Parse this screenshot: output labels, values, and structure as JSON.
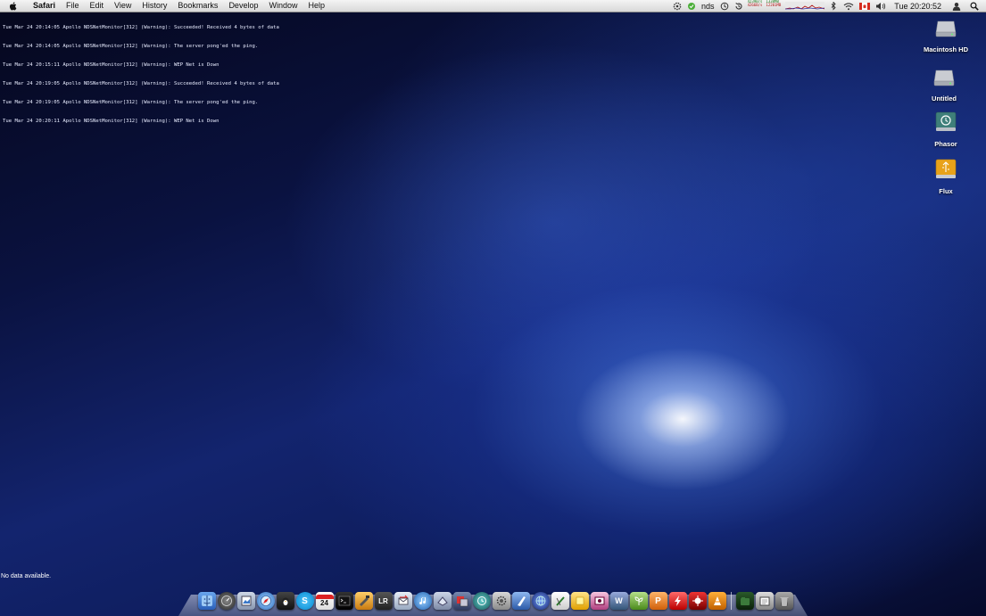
{
  "menubar": {
    "app_name": "Safari",
    "items": [
      "File",
      "Edit",
      "View",
      "History",
      "Bookmarks",
      "Develop",
      "Window",
      "Help"
    ],
    "status_text": "nds",
    "net_up": "4239B/s",
    "net_up_total": "1338MB",
    "net_down": "4266B/s",
    "net_down_total": "12201MB",
    "clock": "Tue 20:20:52"
  },
  "console_log": [
    "Tue Mar 24 20:14:05 Apollo NDSNetMonitor[312] (Warning): Succeeded! Received 4 bytes of data",
    "Tue Mar 24 20:14:05 Apollo NDSNetMonitor[312] (Warning): The server pong'ed the ping.",
    "Tue Mar 24 20:15:11 Apollo NDSNetMonitor[312] (Warning): WEP Net is Down",
    "Tue Mar 24 20:19:05 Apollo NDSNetMonitor[312] (Warning): Succeeded! Received 4 bytes of data",
    "Tue Mar 24 20:19:05 Apollo NDSNetMonitor[312] (Warning): The server pong'ed the ping.",
    "Tue Mar 24 20:20:11 Apollo NDSNetMonitor[312] (Warning): WEP Net is Down"
  ],
  "no_data": "No data available.",
  "desktop_icons": [
    {
      "label": "Macintosh HD",
      "icon": "hard-drive-icon"
    },
    {
      "label": "Untitled",
      "icon": "hard-drive-icon"
    },
    {
      "label": "Phasor",
      "icon": "time-machine-drive-icon"
    },
    {
      "label": "Flux",
      "icon": "usb-drive-icon"
    }
  ],
  "dock": {
    "calendar_day": "24",
    "lightroom_label": "LR",
    "skype_label": "S"
  }
}
